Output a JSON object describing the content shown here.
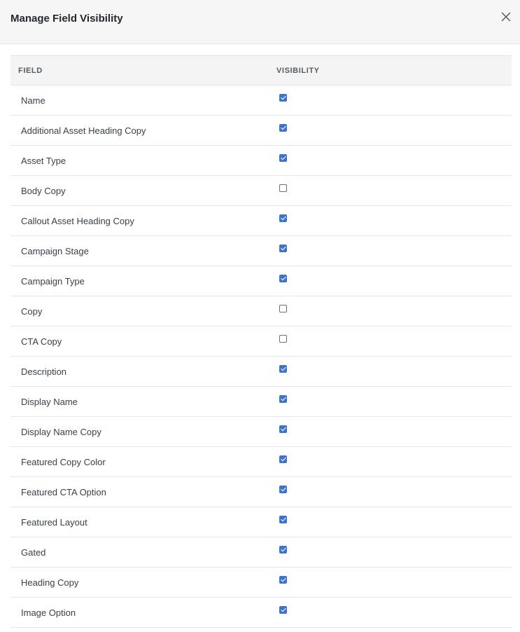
{
  "modal": {
    "title": "Manage Field Visibility",
    "close_icon": "close-icon"
  },
  "table": {
    "headers": {
      "field": "FIELD",
      "visibility": "VISIBILITY"
    },
    "rows": [
      {
        "field": "Name",
        "visible": true
      },
      {
        "field": "Additional Asset Heading Copy",
        "visible": true
      },
      {
        "field": "Asset Type",
        "visible": true
      },
      {
        "field": "Body Copy",
        "visible": false
      },
      {
        "field": "Callout Asset Heading Copy",
        "visible": true
      },
      {
        "field": "Campaign Stage",
        "visible": true
      },
      {
        "field": "Campaign Type",
        "visible": true
      },
      {
        "field": "Copy",
        "visible": false
      },
      {
        "field": "CTA Copy",
        "visible": false
      },
      {
        "field": "Description",
        "visible": true
      },
      {
        "field": "Display Name",
        "visible": true
      },
      {
        "field": "Display Name Copy",
        "visible": true
      },
      {
        "field": "Featured Copy Color",
        "visible": true
      },
      {
        "field": "Featured CTA Option",
        "visible": true
      },
      {
        "field": "Featured Layout",
        "visible": true
      },
      {
        "field": "Gated",
        "visible": true
      },
      {
        "field": "Heading Copy",
        "visible": true
      },
      {
        "field": "Image Option",
        "visible": true
      }
    ]
  },
  "colors": {
    "checkbox_checked": "#3d74c9",
    "header_bg": "#f6f6f6"
  }
}
